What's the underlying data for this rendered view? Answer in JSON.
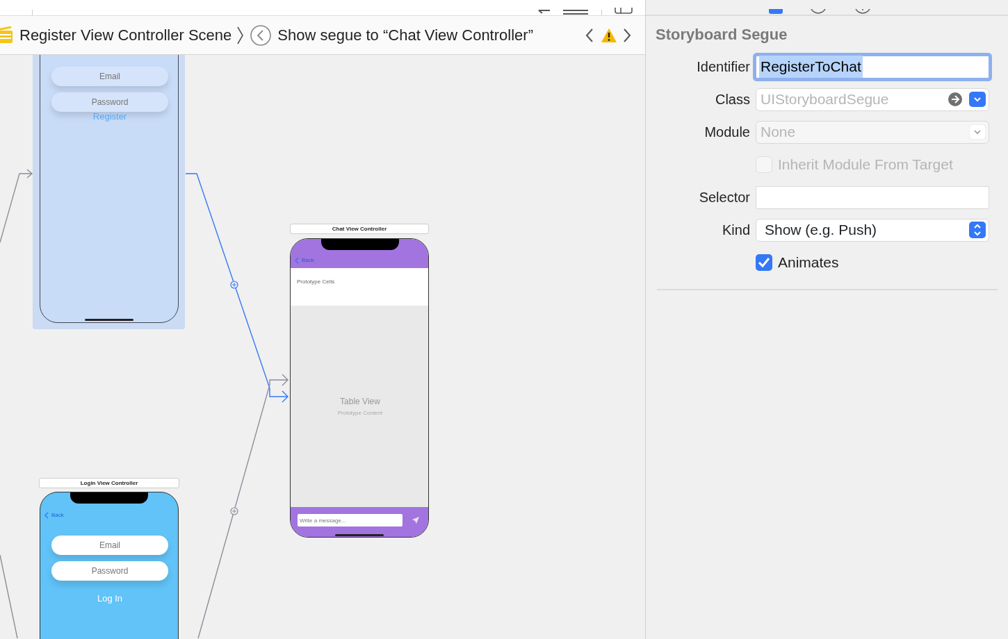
{
  "breadcrumb": {
    "items": [
      {
        "kind": "scene",
        "label": "Register View Controller Scene"
      },
      {
        "kind": "segue",
        "label": "Show segue to “Chat View Controller”"
      }
    ]
  },
  "canvas": {
    "scenes": [
      {
        "kind": "register",
        "selected": true,
        "placeholders": [
          "Email",
          "Password"
        ],
        "button": "Register"
      },
      {
        "kind": "chat",
        "title": "Chat View Controller",
        "back": "Back",
        "section": "Prototype Cells",
        "table_title": "Table View",
        "table_subtitle": "Prototype Content",
        "placeholder": "Write a message..."
      },
      {
        "kind": "login",
        "title": "Login View Controller",
        "back": "Back",
        "placeholders": [
          "Email",
          "Password"
        ],
        "button": "Log In"
      }
    ],
    "segues": [
      {
        "selected": true
      },
      {
        "selected": false
      }
    ]
  },
  "inspector": {
    "title": "Storyboard Segue",
    "rows": [
      {
        "kind": "text",
        "label": "Identifier",
        "value": "RegisterToChat",
        "focused": true
      },
      {
        "kind": "combo",
        "label": "Class",
        "placeholder": "UIStoryboardSegue"
      },
      {
        "kind": "select",
        "label": "Module",
        "placeholder": "None",
        "disabled": true
      },
      {
        "kind": "checkbox",
        "label": "Inherit Module From Target",
        "checked": false,
        "disabled": true
      },
      {
        "kind": "text",
        "label": "Selector",
        "value": "",
        "focused": false
      },
      {
        "kind": "popup",
        "label": "Kind",
        "value": "Show (e.g. Push)"
      },
      {
        "kind": "checkbox",
        "label": "Animates",
        "checked": true,
        "disabled": false
      }
    ]
  }
}
